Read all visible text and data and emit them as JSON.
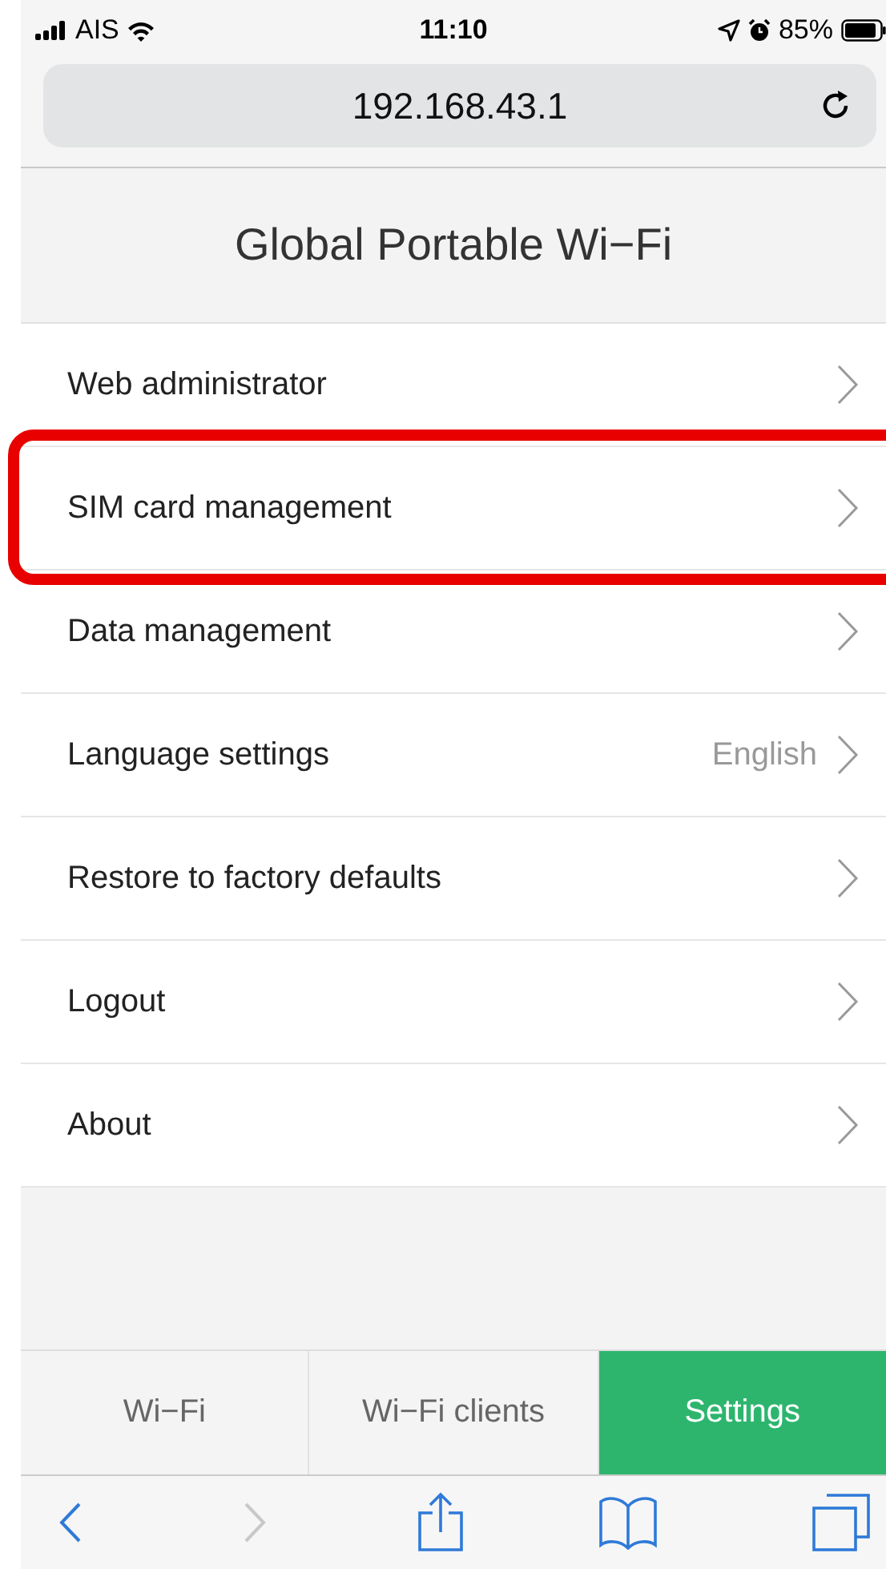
{
  "status_bar": {
    "carrier": "AIS",
    "time": "11:10",
    "battery": "85%"
  },
  "address_bar": {
    "url": "192.168.43.1"
  },
  "page_title": "Global Portable Wi−Fi",
  "menu": [
    {
      "label": "Web administrator",
      "highlighted": false
    },
    {
      "label": "SIM card management",
      "highlighted": true
    },
    {
      "label": "Data management",
      "highlighted": false
    },
    {
      "label": "Language settings",
      "value": "English",
      "highlighted": false
    },
    {
      "label": "Restore to factory defaults",
      "highlighted": false
    },
    {
      "label": "Logout",
      "highlighted": false
    },
    {
      "label": "About",
      "highlighted": false
    }
  ],
  "tabs": [
    {
      "label": "Wi−Fi",
      "selected": false
    },
    {
      "label": "Wi−Fi clients",
      "selected": false
    },
    {
      "label": "Settings",
      "selected": true
    }
  ],
  "toolbar": [
    {
      "kind": "back",
      "disabled": false
    },
    {
      "kind": "forward",
      "disabled": true
    },
    {
      "kind": "share",
      "disabled": false
    },
    {
      "kind": "bookmarks",
      "disabled": false
    },
    {
      "kind": "tabs",
      "disabled": false
    }
  ]
}
